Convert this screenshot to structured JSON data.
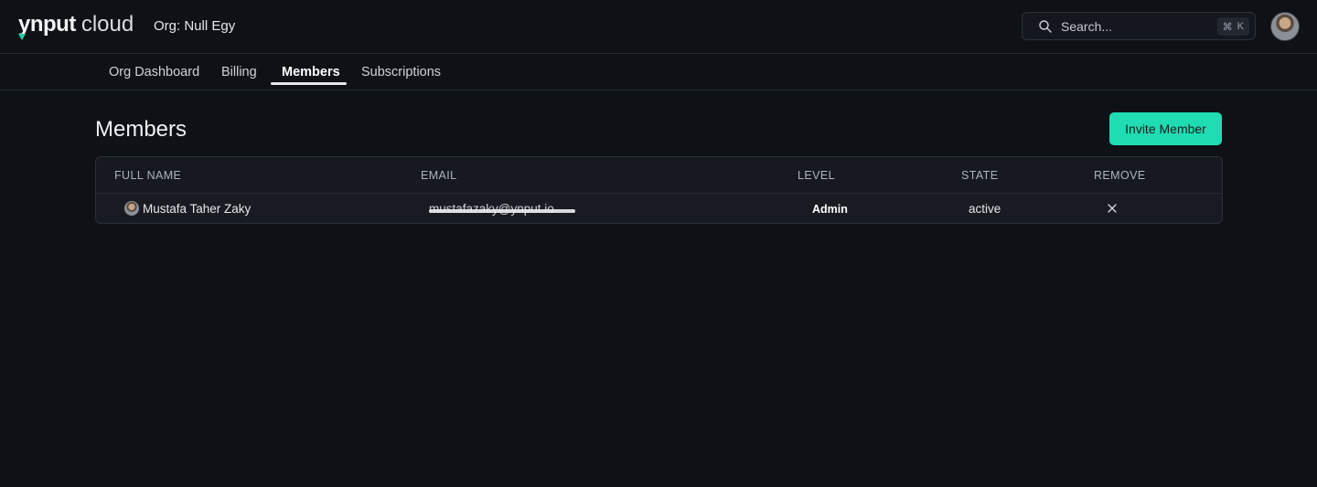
{
  "header": {
    "logo_brand": "ynput",
    "logo_product": "cloud",
    "org_label": "Org: Null Egy",
    "search": {
      "placeholder": "Search...",
      "shortcut_mod": "⌘",
      "shortcut_key": "K",
      "icon": "search-icon"
    },
    "user_avatar": "avatar"
  },
  "tabs": [
    {
      "label": "Org Dashboard",
      "active": false
    },
    {
      "label": "Billing",
      "active": false
    },
    {
      "label": "Members",
      "active": true
    },
    {
      "label": "Subscriptions",
      "active": false
    }
  ],
  "page": {
    "title": "Members",
    "invite_button": "Invite Member"
  },
  "table": {
    "columns": [
      "FULL NAME",
      "EMAIL",
      "LEVEL",
      "STATE",
      "REMOVE"
    ],
    "rows": [
      {
        "full_name": "Mustafa Taher Zaky",
        "email": "mustafazaky@ynput.io",
        "level": "Admin",
        "state": "active",
        "remove_icon": "close-icon"
      }
    ]
  },
  "colors": {
    "background": "#0e1116",
    "accent": "#1fdcb3",
    "border": "#262b33"
  }
}
